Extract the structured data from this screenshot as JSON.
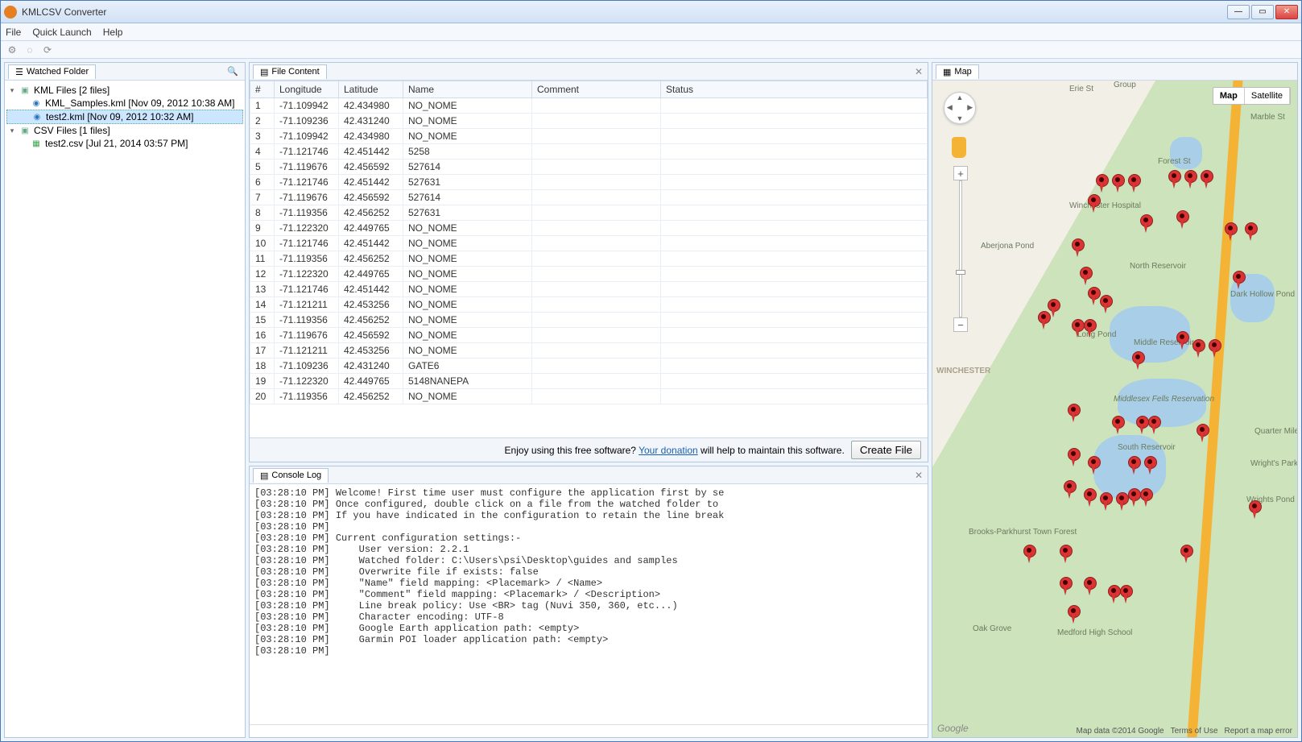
{
  "window": {
    "title": "KMLCSV Converter"
  },
  "menu": {
    "file": "File",
    "quick": "Quick Launch",
    "help": "Help"
  },
  "left": {
    "tab": "Watched Folder",
    "kmlGroup": "KML Files [2 files]",
    "kml1": "KML_Samples.kml [Nov 09, 2012 10:38 AM]",
    "kml2": "test2.kml [Nov 09, 2012 10:32 AM]",
    "csvGroup": "CSV Files [1 files]",
    "csv1": "test2.csv [Jul 21, 2014 03:57 PM]"
  },
  "fileContent": {
    "tab": "File Content",
    "cols": {
      "num": "#",
      "lon": "Longitude",
      "lat": "Latitude",
      "name": "Name",
      "comment": "Comment",
      "status": "Status"
    },
    "rows": [
      {
        "n": "1",
        "lon": "-71.109942",
        "lat": "42.434980",
        "name": "NO_NOME"
      },
      {
        "n": "2",
        "lon": "-71.109236",
        "lat": "42.431240",
        "name": "NO_NOME"
      },
      {
        "n": "3",
        "lon": "-71.109942",
        "lat": "42.434980",
        "name": "NO_NOME"
      },
      {
        "n": "4",
        "lon": "-71.121746",
        "lat": "42.451442",
        "name": "5258"
      },
      {
        "n": "5",
        "lon": "-71.119676",
        "lat": "42.456592",
        "name": "527614"
      },
      {
        "n": "6",
        "lon": "-71.121746",
        "lat": "42.451442",
        "name": "527631"
      },
      {
        "n": "7",
        "lon": "-71.119676",
        "lat": "42.456592",
        "name": "527614"
      },
      {
        "n": "8",
        "lon": "-71.119356",
        "lat": "42.456252",
        "name": "527631"
      },
      {
        "n": "9",
        "lon": "-71.122320",
        "lat": "42.449765",
        "name": "NO_NOME"
      },
      {
        "n": "10",
        "lon": "-71.121746",
        "lat": "42.451442",
        "name": "NO_NOME"
      },
      {
        "n": "11",
        "lon": "-71.119356",
        "lat": "42.456252",
        "name": "NO_NOME"
      },
      {
        "n": "12",
        "lon": "-71.122320",
        "lat": "42.449765",
        "name": "NO_NOME"
      },
      {
        "n": "13",
        "lon": "-71.121746",
        "lat": "42.451442",
        "name": "NO_NOME"
      },
      {
        "n": "14",
        "lon": "-71.121211",
        "lat": "42.453256",
        "name": "NO_NOME"
      },
      {
        "n": "15",
        "lon": "-71.119356",
        "lat": "42.456252",
        "name": "NO_NOME"
      },
      {
        "n": "16",
        "lon": "-71.119676",
        "lat": "42.456592",
        "name": "NO_NOME"
      },
      {
        "n": "17",
        "lon": "-71.121211",
        "lat": "42.453256",
        "name": "NO_NOME"
      },
      {
        "n": "18",
        "lon": "-71.109236",
        "lat": "42.431240",
        "name": "GATE6"
      },
      {
        "n": "19",
        "lon": "-71.122320",
        "lat": "42.449765",
        "name": "5148NANEPA"
      },
      {
        "n": "20",
        "lon": "-71.119356",
        "lat": "42.456252",
        "name": "NO_NOME"
      }
    ]
  },
  "donation": {
    "pre": "Enjoy using this free software? ",
    "link": "Your donation",
    "post": " will help to maintain this software.",
    "btn": "Create File"
  },
  "console": {
    "tab": "Console Log",
    "lines": [
      "[03:28:10 PM] Welcome! First time user must configure the application first by se",
      "[03:28:10 PM] Once configured, double click on a file from the watched folder to ",
      "[03:28:10 PM] If you have indicated in the configuration to retain the line break",
      "[03:28:10 PM] ",
      "[03:28:10 PM] Current configuration settings:-",
      "[03:28:10 PM]     User version: 2.2.1",
      "[03:28:10 PM]     Watched folder: C:\\Users\\psi\\Desktop\\guides and samples",
      "[03:28:10 PM]     Overwrite file if exists: false",
      "[03:28:10 PM]     \"Name\" field mapping: <Placemark> / <Name>",
      "[03:28:10 PM]     \"Comment\" field mapping: <Placemark> / <Description>",
      "[03:28:10 PM]     Line break policy: Use <BR> tag (Nuvi 350, 360, etc...)",
      "[03:28:10 PM]     Character encoding: UTF-8",
      "[03:28:10 PM]     Google Earth application path: <empty>",
      "[03:28:10 PM]     Garmin POI loader application path: <empty>",
      "[03:28:10 PM] "
    ]
  },
  "map": {
    "tab": "Map",
    "typeMap": "Map",
    "typeSat": "Satellite",
    "labels": {
      "winhosp": "Winchester Hospital",
      "northres": "North Reservoir",
      "midres": "Middle Reservoir",
      "fells": "Middlesex Fells Reservation",
      "southres": "South Reservoir",
      "abpond": "Aberjona Pond",
      "longpond": "Long Pond",
      "darkhollow": "Dark Hollow Pond",
      "quarter": "Quarter Mile Pond",
      "wrights": "Wright's Park",
      "wrightspond": "Wrights Pond",
      "oakgrove": "Oak Grove",
      "medford": "Medford High School",
      "winchester": "WINCHESTER",
      "brooks": "Brooks-Parkhurst Town Forest",
      "group": "Group",
      "eriest": "Erie St",
      "marble": "Marble St",
      "forest": "Forest St"
    },
    "footer": {
      "data": "Map data ©2014 Google",
      "terms": "Terms of Use",
      "report": "Report a map error"
    },
    "logo": "Google"
  }
}
